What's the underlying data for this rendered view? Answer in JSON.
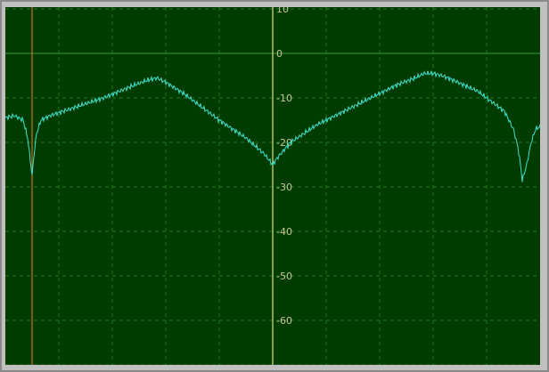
{
  "chart_data": {
    "type": "line",
    "title": "",
    "xlabel": "",
    "ylabel": "",
    "ylim": [
      -70,
      10
    ],
    "y_ticks": [
      10,
      0,
      -10,
      -20,
      -30,
      -40,
      -50,
      -60
    ],
    "y_tick_labels": [
      "10",
      "0",
      "-10",
      "-20",
      "-30",
      "-40",
      "-50",
      "-60"
    ],
    "xlim": [
      0,
      600
    ],
    "grid": true,
    "markers": [
      {
        "x": 30,
        "kind": "cursor-left"
      },
      {
        "x": 300,
        "kind": "cursor-center"
      }
    ],
    "series": [
      {
        "x": [
          0,
          10,
          20,
          25,
          28,
          30,
          32,
          35,
          40,
          50,
          80,
          110,
          140,
          160,
          170,
          180,
          200,
          240,
          270,
          290,
          300,
          305,
          320,
          350,
          380,
          410,
          440,
          460,
          470,
          480,
          490,
          500,
          530,
          560,
          570,
          575,
          578,
          580,
          585,
          590,
          595,
          600
        ],
        "values": [
          -14.5,
          -14,
          -15,
          -19,
          -24,
          -27.5,
          -23,
          -18,
          -15,
          -14,
          -12,
          -10,
          -7.5,
          -6,
          -5.5,
          -6.5,
          -9,
          -15,
          -19,
          -22.5,
          -25,
          -23.5,
          -20,
          -16,
          -13,
          -10,
          -7,
          -5.5,
          -4.5,
          -4.5,
          -5,
          -5.8,
          -8.5,
          -13,
          -17,
          -21,
          -25,
          -28.5,
          -25,
          -20,
          -17,
          -16.5
        ]
      }
    ],
    "colors": {
      "background": "#003c00",
      "grid": "#1e7a1e",
      "zero_line": "#3c963c",
      "trace": "#40e0d0",
      "marker_left": "#d2691e",
      "marker_center": "#e8e070",
      "tick_label": "#c8c896"
    }
  }
}
